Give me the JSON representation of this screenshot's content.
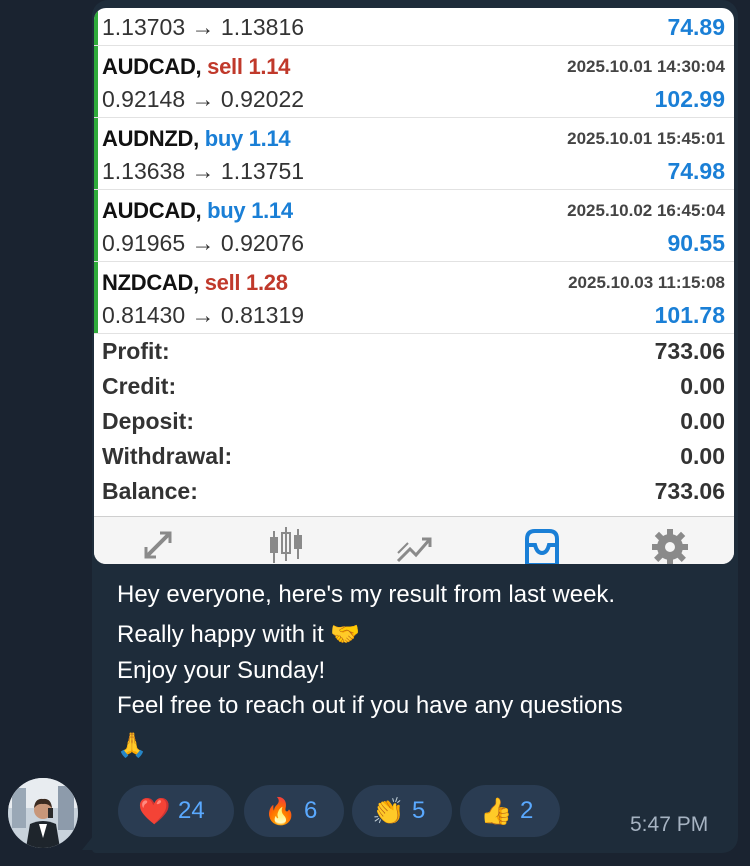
{
  "trades": [
    {
      "symbol": "",
      "side": "",
      "lot": "",
      "date": "",
      "prices": "1.13703 → 1.13816",
      "profit": "74.89"
    },
    {
      "symbol": "AUDCAD,",
      "side": "sell",
      "lot": "1.14",
      "date": "2025.10.01 14:30:04",
      "prices": "0.92148 → 0.92022",
      "profit": "102.99"
    },
    {
      "symbol": "AUDNZD,",
      "side": "buy",
      "lot": "1.14",
      "date": "2025.10.01 15:45:01",
      "prices": "1.13638 → 1.13751",
      "profit": "74.98"
    },
    {
      "symbol": "AUDCAD,",
      "side": "buy",
      "lot": "1.14",
      "date": "2025.10.02 16:45:04",
      "prices": "0.91965 → 0.92076",
      "profit": "90.55"
    },
    {
      "symbol": "NZDCAD,",
      "side": "sell",
      "lot": "1.28",
      "date": "2025.10.03 11:15:08",
      "prices": "0.81430 → 0.81319",
      "profit": "101.78"
    }
  ],
  "summary": [
    {
      "label": "Profit:",
      "value": "733.06"
    },
    {
      "label": "Credit:",
      "value": "0.00"
    },
    {
      "label": "Deposit:",
      "value": "0.00"
    },
    {
      "label": "Withdrawal:",
      "value": "0.00"
    },
    {
      "label": "Balance:",
      "value": "733.06"
    }
  ],
  "tabbar": {
    "icons": [
      "quotes-icon",
      "chart-icon",
      "trade-icon",
      "history-icon",
      "settings-icon"
    ],
    "active": "history-icon",
    "active_color": "#1a7fd6"
  },
  "message": {
    "lines": [
      "Hey everyone, here's my result from last week.",
      "Really happy with it 🤝",
      "Enjoy your Sunday!",
      "Feel free to reach out if you have any questions",
      "🙏"
    ],
    "time": "5:47 PM"
  },
  "reactions": [
    {
      "emoji": "❤️",
      "count": "24"
    },
    {
      "emoji": "🔥",
      "count": "6"
    },
    {
      "emoji": "👏",
      "count": "5"
    },
    {
      "emoji": "👍",
      "count": "2"
    }
  ],
  "colors": {
    "background": "#1a2330",
    "bubble": "#1e2c3a",
    "sell": "#c0392b",
    "buy": "#1a7fd6",
    "reaction_count": "#5aa9ff"
  }
}
